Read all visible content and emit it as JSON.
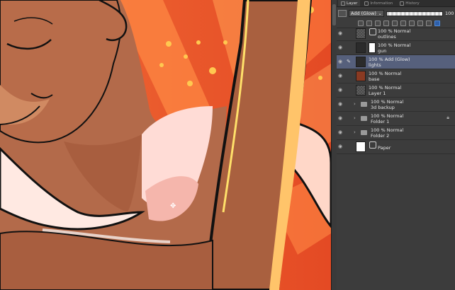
{
  "tabs": [
    {
      "label": "Layer",
      "active": true
    },
    {
      "label": "Information",
      "active": false
    },
    {
      "label": "History",
      "active": false
    }
  ],
  "blend": {
    "mode": "Add (Glow)",
    "opacity": "100"
  },
  "layers": [
    {
      "mode": "100 % Normal",
      "name": "outlines",
      "type": "ref"
    },
    {
      "mode": "100 % Normal",
      "name": "gun",
      "type": "masked"
    },
    {
      "mode": "100 % Add (Glow)",
      "name": "lights",
      "type": "raster",
      "selected": true
    },
    {
      "mode": "100 % Normal",
      "name": "base",
      "type": "raster"
    },
    {
      "mode": "100 % Normal",
      "name": "Layer 1",
      "type": "raster"
    },
    {
      "mode": "100 % Normal",
      "name": "3d backup",
      "type": "folder"
    },
    {
      "mode": "100 % Normal",
      "name": "Folder 1",
      "type": "folder",
      "locked": true
    },
    {
      "mode": "100 % Normal",
      "name": "Folder 2",
      "type": "folder"
    },
    {
      "mode": "",
      "name": "Paper",
      "type": "paper"
    }
  ],
  "colors": {
    "selected": "#56607c",
    "panel": "#3c3c3c",
    "canvas_bg": "#e8562c"
  }
}
